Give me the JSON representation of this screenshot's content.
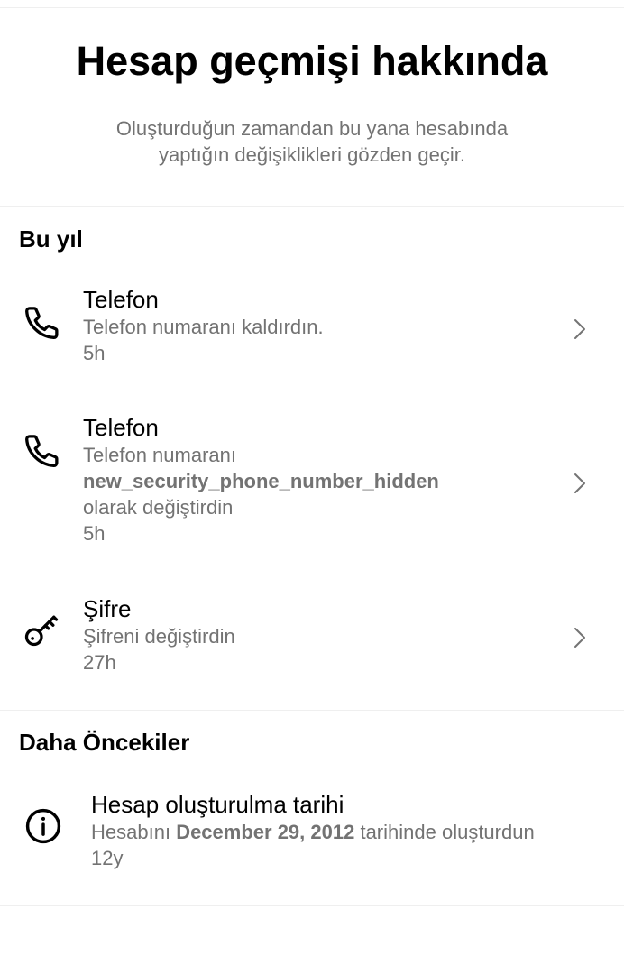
{
  "header": {
    "title": "Hesap geçmişi hakkında",
    "subtitle": "Oluşturduğun zamandan bu yana hesabında yaptığın değişiklikleri gözden geçir."
  },
  "sections": [
    {
      "heading": "Bu yıl",
      "items": [
        {
          "icon": "phone-icon",
          "title": "Telefon",
          "description": "Telefon numaranı kaldırdın.",
          "time": "5h"
        },
        {
          "icon": "phone-icon",
          "title": "Telefon",
          "description_prefix": "Telefon numaranı",
          "description_bold": "new_security_phone_number_hidden",
          "description_suffix": "olarak değiştirdin",
          "time": "5h"
        },
        {
          "icon": "key-icon",
          "title": "Şifre",
          "description": "Şifreni değiştirdin",
          "time": "27h"
        }
      ]
    },
    {
      "heading": "Daha Öncekiler",
      "items": [
        {
          "icon": "info-icon",
          "title": "Hesap oluşturulma tarihi",
          "description_prefix": "Hesabını",
          "description_bold": "December 29, 2012",
          "description_suffix": "tarihinde oluşturdun",
          "time": "12y"
        }
      ]
    }
  ]
}
